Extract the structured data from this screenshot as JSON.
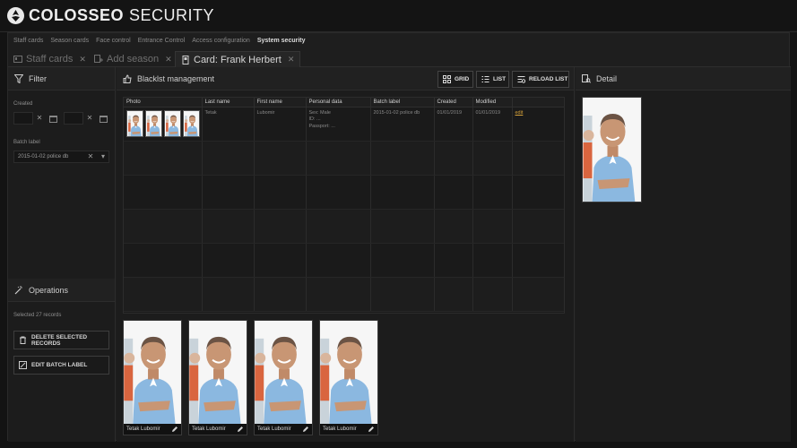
{
  "app": {
    "brand": "COLOSSEO",
    "product": "SECURITY"
  },
  "menu": [
    "Staff cards",
    "Season cards",
    "Face control",
    "Entrance Control",
    "Access configuration",
    "System security"
  ],
  "tabs": [
    {
      "label": "Staff cards",
      "close": "✕"
    },
    {
      "label": "Add season",
      "close": "✕"
    },
    {
      "label": "Card: Frank Herbert",
      "close": "✕"
    }
  ],
  "filter": {
    "title": "Filter",
    "created_label": "Created",
    "batch_label": "Batch label",
    "batch_value": "2015-01-02 police db",
    "clear": "✕",
    "dropdown": "▾"
  },
  "operations": {
    "title": "Operations",
    "selected_text": "Selected 27 records",
    "delete_label": "DELETE SELECTED RECORDS",
    "edit_label": "EDIT BATCH LABEL"
  },
  "blacklist": {
    "title": "Blacklst management",
    "buttons": {
      "grid": "GRID",
      "list": "LIST",
      "reload": "RELOAD LIST"
    },
    "columns": [
      "Photo",
      "Last name",
      "First name",
      "Personal data",
      "Batch label",
      "Created",
      "Modified",
      ""
    ],
    "row": {
      "last_name": "Tetak",
      "first_name": "Lubomir",
      "personal_sex": "Sex: Male",
      "personal_id": "ID: ...",
      "personal_passport": "Passport: ...",
      "batch_label": "2015-01-02 police db",
      "created": "01/01/2019",
      "modified": "01/01/2019",
      "action": "edit"
    },
    "cards": [
      {
        "name": "Tetak Lubomir"
      },
      {
        "name": "Tetak Lubomir"
      },
      {
        "name": "Tetak Lubomir"
      },
      {
        "name": "Tetak Lubomir"
      }
    ]
  },
  "detail": {
    "title": "Detail"
  },
  "colors": {
    "accent": "#d6a23a",
    "background": "#1c1c1c",
    "shirt": "#8bb8e0",
    "skin": "#c89674"
  }
}
